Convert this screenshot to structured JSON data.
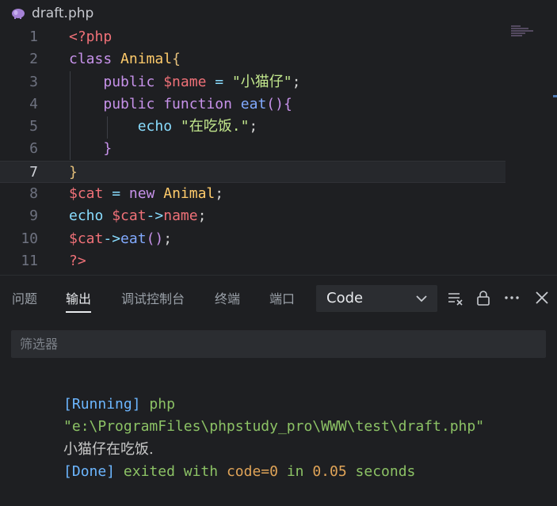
{
  "editor": {
    "file_name": "draft.php",
    "file_icon": "elephant-php-icon",
    "active_line": 7,
    "lines": [
      {
        "n": "1",
        "tokens": [
          {
            "t": "<?php",
            "c": "kw-red"
          }
        ]
      },
      {
        "n": "2",
        "tokens": [
          {
            "t": "class ",
            "c": "kw-pur"
          },
          {
            "t": "Animal",
            "c": "kw-cls"
          },
          {
            "t": "{",
            "c": "kw-yel"
          }
        ]
      },
      {
        "n": "3",
        "tokens": [
          {
            "t": "    ",
            "c": "plain"
          },
          {
            "t": "public ",
            "c": "kw-pur"
          },
          {
            "t": "$name",
            "c": "kw-red"
          },
          {
            "t": " = ",
            "c": "kw-cyan"
          },
          {
            "t": "\"小猫仔\"",
            "c": "str"
          },
          {
            "t": ";",
            "c": "plain"
          }
        ]
      },
      {
        "n": "4",
        "tokens": [
          {
            "t": "    ",
            "c": "plain"
          },
          {
            "t": "public ",
            "c": "kw-pur"
          },
          {
            "t": "function ",
            "c": "kw-pur"
          },
          {
            "t": "eat",
            "c": "kw-blue"
          },
          {
            "t": "(){",
            "c": "kw-pur"
          }
        ]
      },
      {
        "n": "5",
        "tokens": [
          {
            "t": "        ",
            "c": "plain"
          },
          {
            "t": "echo ",
            "c": "kw-cyan"
          },
          {
            "t": "\"在吃饭.\"",
            "c": "str"
          },
          {
            "t": ";",
            "c": "plain"
          }
        ]
      },
      {
        "n": "6",
        "tokens": [
          {
            "t": "    ",
            "c": "plain"
          },
          {
            "t": "}",
            "c": "kw-pur"
          }
        ]
      },
      {
        "n": "7",
        "tokens": [
          {
            "t": "}",
            "c": "kw-yel"
          }
        ]
      },
      {
        "n": "8",
        "tokens": [
          {
            "t": "$cat",
            "c": "kw-red"
          },
          {
            "t": " = ",
            "c": "kw-cyan"
          },
          {
            "t": "new ",
            "c": "kw-pur"
          },
          {
            "t": "Animal",
            "c": "kw-cls"
          },
          {
            "t": ";",
            "c": "plain"
          }
        ]
      },
      {
        "n": "9",
        "tokens": [
          {
            "t": "echo ",
            "c": "kw-cyan"
          },
          {
            "t": "$cat",
            "c": "kw-red"
          },
          {
            "t": "->",
            "c": "kw-cyan"
          },
          {
            "t": "name",
            "c": "kw-red"
          },
          {
            "t": ";",
            "c": "plain"
          }
        ]
      },
      {
        "n": "10",
        "tokens": [
          {
            "t": "$cat",
            "c": "kw-red"
          },
          {
            "t": "->",
            "c": "kw-cyan"
          },
          {
            "t": "eat",
            "c": "kw-blue"
          },
          {
            "t": "()",
            "c": "kw-pur"
          },
          {
            "t": ";",
            "c": "plain"
          }
        ]
      },
      {
        "n": "11",
        "tokens": [
          {
            "t": "?>",
            "c": "kw-red"
          }
        ]
      }
    ]
  },
  "panel": {
    "tabs": [
      {
        "label": "问题",
        "active": false
      },
      {
        "label": "输出",
        "active": true
      },
      {
        "label": "调试控制台",
        "active": false
      },
      {
        "label": "终端",
        "active": false
      },
      {
        "label": "端口",
        "active": false
      }
    ],
    "output_channel": "Code",
    "toolbar_icons": [
      "clear-output-icon",
      "lock-icon",
      "more-actions-icon",
      "close-icon"
    ],
    "filter_placeholder": "筛选器",
    "output": {
      "line1": {
        "a": "[Running]",
        "b": " php"
      },
      "line2": "\"e:\\ProgramFiles\\phpstudy_pro\\WWW\\test\\draft.php\"",
      "line3": "小猫仔在吃饭.",
      "line4": {
        "a": "[Done]",
        "b": " exited with ",
        "c": "code=0",
        "d": " in ",
        "e": "0.05",
        "f": " seconds"
      }
    }
  },
  "colors": {
    "background": "#1e1f22",
    "accent_blue": "#6cb6ff",
    "output_green": "#8cc265"
  }
}
